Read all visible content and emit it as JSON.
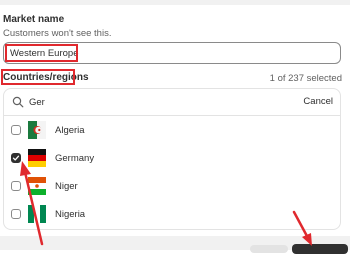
{
  "market": {
    "label": "Market name",
    "help": "Customers won't see this.",
    "value": "Western Europe"
  },
  "countries": {
    "label": "Countries/regions",
    "selected_count": "1 of 237 selected",
    "search_value": "Ger",
    "cancel_label": "Cancel",
    "items": [
      {
        "label": "Algeria",
        "checked": false,
        "flag": "algeria-flag"
      },
      {
        "label": "Germany",
        "checked": true,
        "flag": "germany-flag"
      },
      {
        "label": "Niger",
        "checked": false,
        "flag": "niger-flag"
      },
      {
        "label": "Nigeria",
        "checked": false,
        "flag": "nigeria-flag"
      }
    ]
  },
  "colors": {
    "annotation_red": "#e0292e",
    "text": "#303030",
    "muted": "#616161"
  }
}
